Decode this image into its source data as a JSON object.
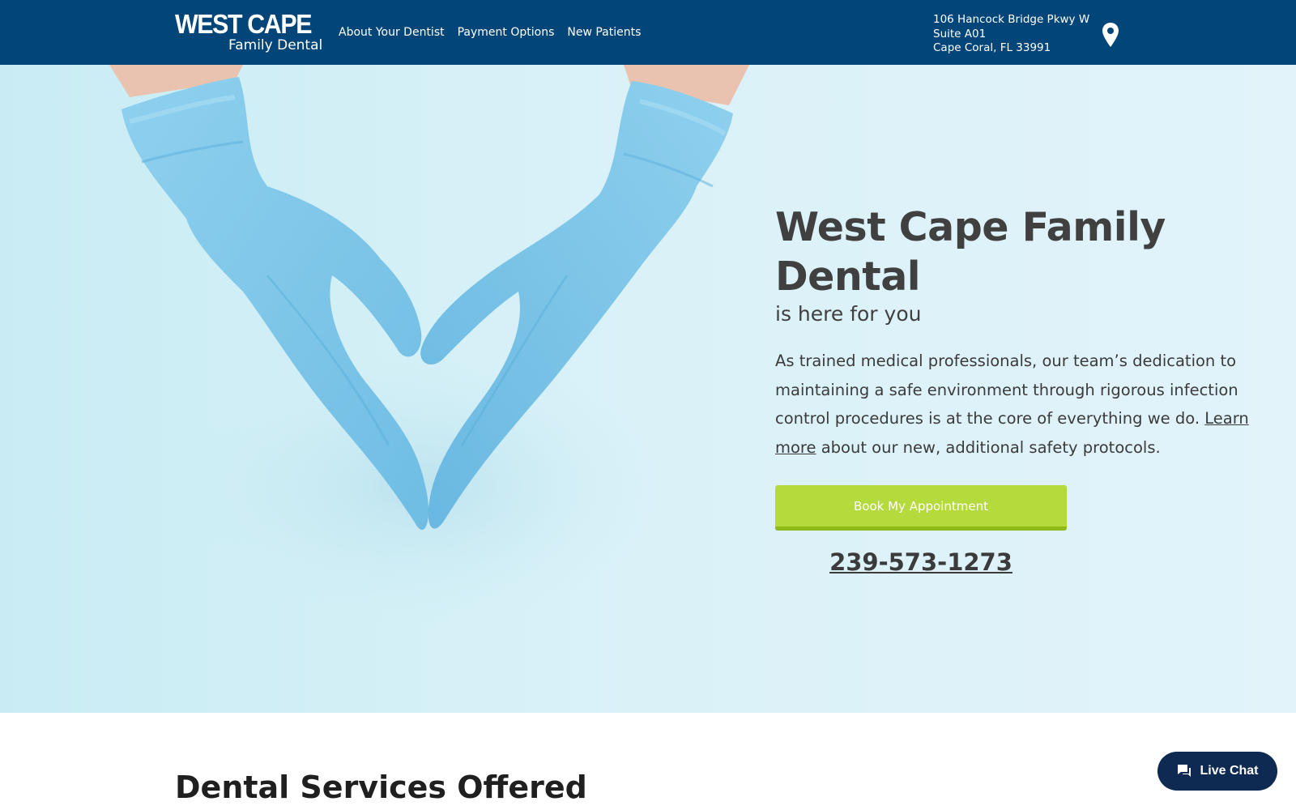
{
  "header": {
    "logo": {
      "line1": "WEST CAPE",
      "line2": "Family Dental"
    },
    "nav": [
      {
        "label": "About Your Dentist"
      },
      {
        "label": "Payment Options"
      },
      {
        "label": "New Patients"
      }
    ],
    "address": {
      "line1": "106 Hancock Bridge Pkwy W",
      "line2": "Suite A01",
      "line3": "Cape Coral, FL 33991"
    },
    "location_icon": "map-pin-icon"
  },
  "hero": {
    "image": "gloved-hands-heart",
    "title": "West Cape Family Dental",
    "subtitle": "is here for you",
    "body_before": "As trained medical professionals, our team’s dedication to maintaining a safe environment through rigorous infection control procedures is at the core of everything we do. ",
    "body_link": "Learn more",
    "body_after": " about our new, additional safety protocols.",
    "book_button": "Book My Appointment",
    "phone": "239-573-1273"
  },
  "services": {
    "title": "Dental Services Offered"
  },
  "chat": {
    "label": "Live Chat",
    "icon": "chat-bubble-icon"
  },
  "colors": {
    "header_bg": "#014579",
    "hero_bg": "#d9f1f8",
    "glove": "#7cc3e6",
    "button": "#b5da3b",
    "chat_bg": "#0e2a52"
  }
}
